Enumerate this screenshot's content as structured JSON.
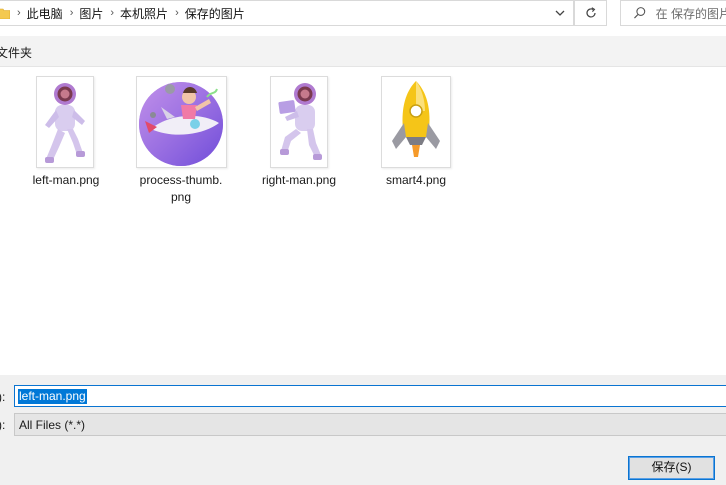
{
  "address_bar": {
    "breadcrumbs": [
      "此电脑",
      "图片",
      "本机照片",
      "保存的图片"
    ],
    "icons": {
      "folder": "folder-icon",
      "separator": "chevron-right-icon",
      "dropdown": "chevron-down-icon",
      "refresh": "refresh-icon"
    }
  },
  "search": {
    "placeholder": "在 保存的图片",
    "icon": "search-icon"
  },
  "section": {
    "title": "文件夹"
  },
  "files": [
    {
      "name": "left-man.png"
    },
    {
      "name": "process-thumb.png",
      "name_lines": [
        "process-thumb.",
        "png"
      ]
    },
    {
      "name": "right-man.png"
    },
    {
      "name": "smart4.png"
    }
  ],
  "footer": {
    "filename_label": "):",
    "filename_value": "left-man.png",
    "filetype_label": "):",
    "filetype_value": "All Files (*.*)",
    "save_button_label": "保存(S)"
  },
  "colors": {
    "accent": "#0078d7",
    "panel": "#f0f0f0",
    "header": "#f3f3f3",
    "rocket_yellow": "#f5c518",
    "astronaut_lilac": "#c9b6e6"
  }
}
